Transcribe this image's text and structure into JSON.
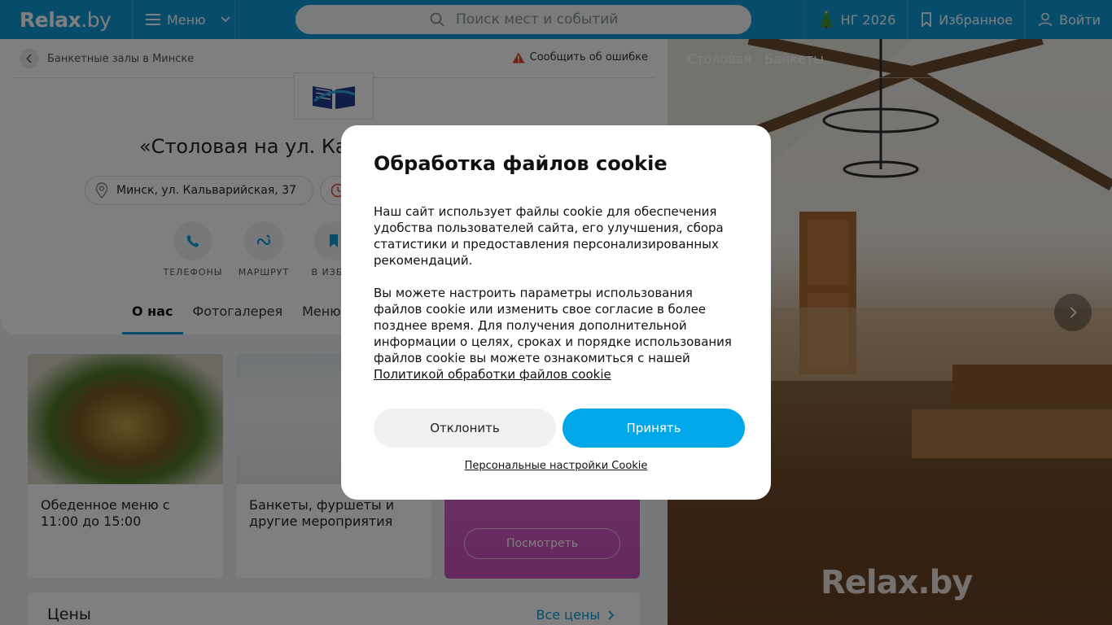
{
  "header": {
    "logo_main": "Relax",
    "logo_suffix": ".by",
    "menu_label": "Меню",
    "search_placeholder": "Поиск мест и событий",
    "ny_label": "НГ 2026",
    "favorites_label": "Избранное",
    "login_label": "Войти"
  },
  "breadcrumb": {
    "label": "Банкетные залы в Минске"
  },
  "report_error": "Сообщить об ошибке",
  "place": {
    "title": "«Столовая на ул. Ка",
    "address": "Минск, ул. Кальварийская, 37"
  },
  "actions": [
    {
      "label": "ТЕЛЕФОНЫ",
      "icon": "phone-icon"
    },
    {
      "label": "МАРШРУТ",
      "icon": "route-icon"
    },
    {
      "label": "В ИЗБРА",
      "icon": "bookmark-icon"
    }
  ],
  "tabs": [
    {
      "label": "О нас",
      "active": true
    },
    {
      "label": "Фотогалерея",
      "active": false
    },
    {
      "label": "Меню и",
      "active": false
    }
  ],
  "promos": [
    {
      "text": "Обеденное меню с 11:00 до 15:00"
    },
    {
      "text": "Банкеты, фуршеты и другие мероприятия"
    },
    {
      "button": "Посмотреть"
    }
  ],
  "prices": {
    "title": "Цены",
    "all_label": "Все цены"
  },
  "photo": {
    "tags": [
      "Столовая",
      "Банкеты"
    ],
    "watermark": "Relax.by"
  },
  "cookie_modal": {
    "title": "Обработка файлов cookie",
    "paragraph1": "Наш сайт использует файлы cookie для обеспечения удобства пользователей сайта, его улучшения, сбора статистики и предоставления персонализированных рекомендаций.",
    "paragraph2": "Вы можете настроить параметры использования файлов cookie или изменить свое согласие в более позднее время. Для получения дополнительной информации о целях, сроках и порядке использования файлов cookie вы можете ознакомиться с нашей",
    "policy_link": "Политикой обработки файлов cookie",
    "decline_label": "Отклонить",
    "accept_label": "Принять",
    "personal_settings": "Персональные настройки Cookie"
  },
  "colors": {
    "brand": "#0e9ad6",
    "accept": "#00a8ea",
    "promo_pink": "#d15fc5"
  }
}
